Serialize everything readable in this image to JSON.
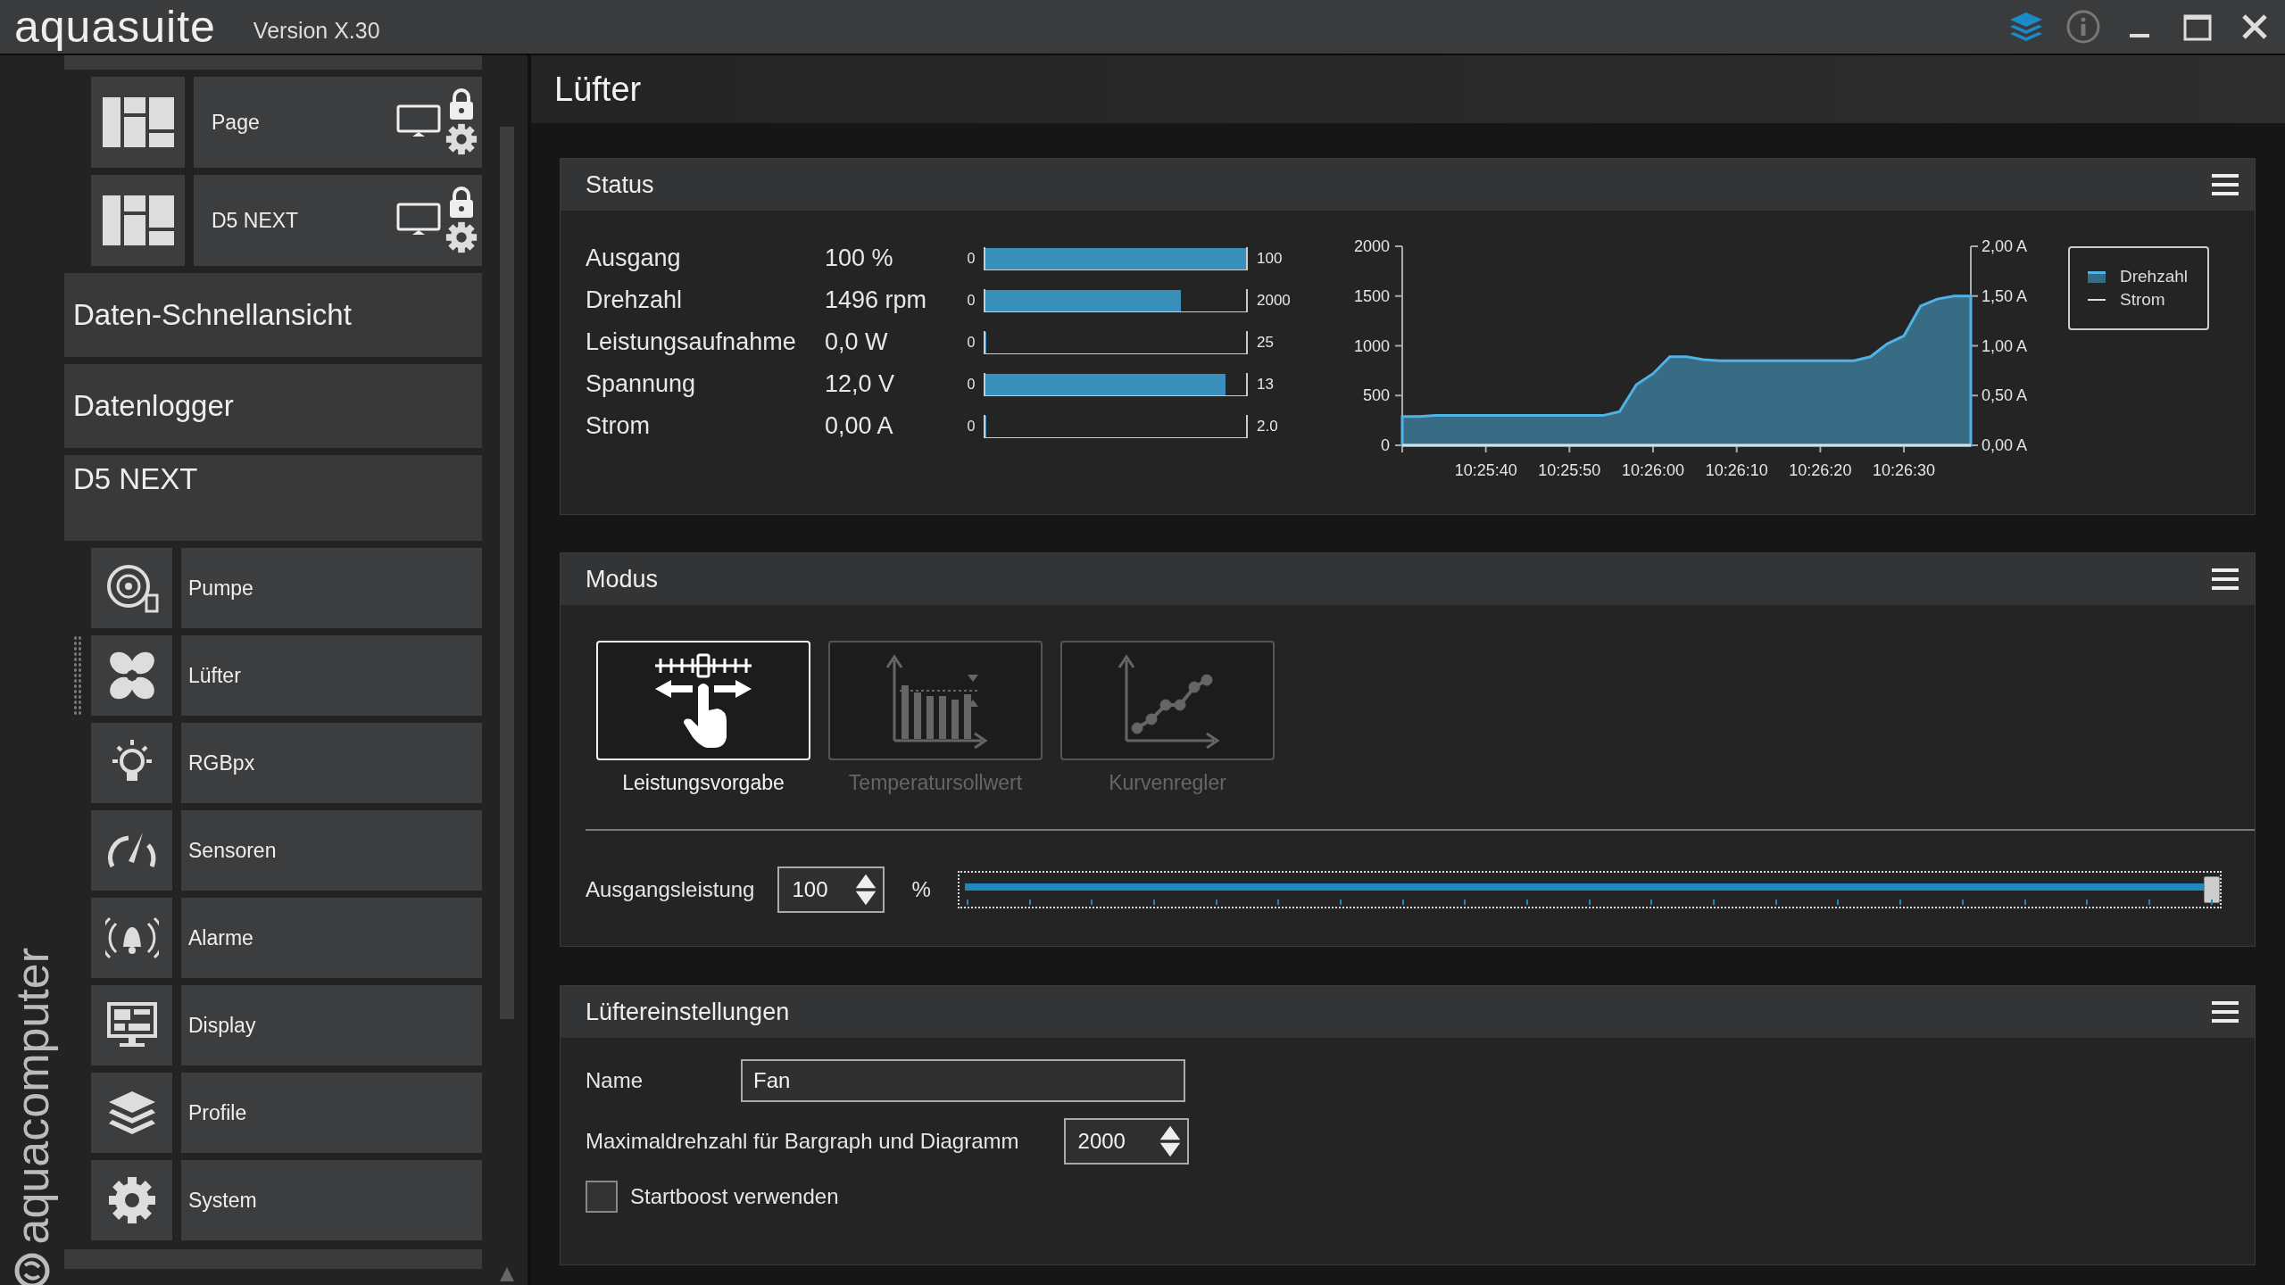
{
  "titlebar": {
    "logo": "aquasuite",
    "version": "Version X.30"
  },
  "sidebar": {
    "brand": "aquacomputer",
    "pages": [
      {
        "label": "Page"
      },
      {
        "label": "D5 NEXT"
      }
    ],
    "sections": [
      "Daten-Schnellansicht",
      "Datenlogger"
    ],
    "device": "D5 NEXT",
    "items": [
      {
        "label": "Pumpe",
        "selected": false
      },
      {
        "label": "Lüfter",
        "selected": true
      },
      {
        "label": "RGBpx",
        "selected": false
      },
      {
        "label": "Sensoren",
        "selected": false
      },
      {
        "label": "Alarme",
        "selected": false
      },
      {
        "label": "Display",
        "selected": false
      },
      {
        "label": "Profile",
        "selected": false
      },
      {
        "label": "System",
        "selected": false
      }
    ]
  },
  "page_title": "Lüfter",
  "status": {
    "title": "Status",
    "rows": [
      {
        "label": "Ausgang",
        "value": "100 %",
        "min": "0",
        "max": "100",
        "level": 1.0
      },
      {
        "label": "Drehzahl",
        "value": "1496 rpm",
        "min": "0",
        "max": "2000",
        "level": 0.75
      },
      {
        "label": "Leistungsaufnahme",
        "value": "0,0 W",
        "min": "0",
        "max": "25",
        "level": 0
      },
      {
        "label": "Spannung",
        "value": "12,0 V",
        "min": "0",
        "max": "13",
        "level": 0.92
      },
      {
        "label": "Strom",
        "value": "0,00 A",
        "min": "0",
        "max": "2.0",
        "level": 0
      }
    ],
    "chart_data": {
      "type": "area",
      "categories": [
        null,
        null,
        null,
        null,
        null,
        "10:25:40",
        null,
        null,
        null,
        null,
        "10:25:50",
        null,
        null,
        null,
        null,
        "10:26:00",
        null,
        null,
        null,
        null,
        "10:26:10",
        null,
        null,
        null,
        null,
        "10:26:20",
        null,
        null,
        null,
        null,
        "10:26:30",
        null,
        null,
        null,
        null
      ],
      "series": [
        {
          "name": "Drehzahl",
          "color": "#4fb3e8",
          "axis": "y",
          "values": [
            290,
            290,
            300,
            300,
            300,
            300,
            300,
            300,
            300,
            300,
            300,
            300,
            300,
            340,
            610,
            720,
            890,
            890,
            860,
            850,
            850,
            850,
            850,
            850,
            850,
            850,
            850,
            850,
            890,
            1020,
            1100,
            1400,
            1470,
            1500,
            1500
          ]
        },
        {
          "name": "Strom",
          "color": "#dddddd",
          "axis": "y2",
          "type": "line",
          "values": [
            0,
            0,
            0,
            0,
            0,
            0,
            0,
            0,
            0,
            0,
            0,
            0,
            0,
            0,
            0,
            0,
            0,
            0,
            0,
            0,
            0,
            0,
            0,
            0,
            0,
            0,
            0,
            0,
            0,
            0,
            0,
            0,
            0,
            0,
            0
          ]
        }
      ],
      "ylim": [
        0,
        2000
      ],
      "y2lim": [
        0,
        2
      ],
      "yticks": [
        0,
        500,
        1000,
        1500,
        2000
      ],
      "y2ticks": [
        {
          "value": 0,
          "label": "0,00 A"
        },
        {
          "value": 0.5,
          "label": "0,50 A"
        },
        {
          "value": 1,
          "label": "1,00 A"
        },
        {
          "value": 1.5,
          "label": "1,50 A"
        },
        {
          "value": 2,
          "label": "2,00 A"
        }
      ]
    }
  },
  "modus": {
    "title": "Modus",
    "modes": [
      {
        "label": "Leistungsvorgabe",
        "selected": true
      },
      {
        "label": "Temperatursollwert",
        "selected": false
      },
      {
        "label": "Kurvenregler",
        "selected": false
      }
    ],
    "output": {
      "label": "Ausgangsleistung",
      "value": "100",
      "unit": "%",
      "level": 1.0
    }
  },
  "settings": {
    "title": "Lüftereinstellungen",
    "name": {
      "label": "Name",
      "value": "Fan"
    },
    "max_rpm": {
      "label": "Maximaldrehzahl für Bargraph und Diagramm",
      "value": "2000"
    },
    "startboost": {
      "label": "Startboost verwenden",
      "checked": false
    }
  }
}
